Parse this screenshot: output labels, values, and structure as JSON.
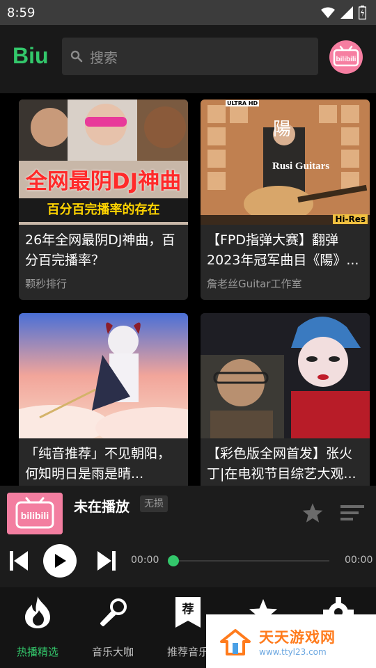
{
  "status_bar": {
    "time": "8:59"
  },
  "app_bar": {
    "logo": "Biu",
    "search": {
      "placeholder": "搜索"
    },
    "avatar_text": "bilibili"
  },
  "cards": [
    {
      "title": "26年全网最阴DJ神曲，百分百完播率？",
      "author": "颗秒排行",
      "thumb_text": "全网最阴DJ神曲",
      "thumb_sub": "百分百完播率的存在"
    },
    {
      "title": "【FPD指弹大赛】翻弹2023年冠军曲目《陽》...",
      "author": "詹老丝Guitar工作室",
      "thumb_text": "陽",
      "thumb_sub": "Rusi Guitars",
      "badge_tl": "ULTRA HD",
      "badge_br": "Hi-Res"
    },
    {
      "title": "「纯音推荐」不见朝阳，何知明日是雨是晴...",
      "author": ""
    },
    {
      "title": "【彩色版全网首发】张火丁|在电视节目综艺大观...",
      "author": ""
    }
  ],
  "player": {
    "title": "未在播放",
    "quality": "无损",
    "current_time": "00:00",
    "total_time": "00:00",
    "progress": 0
  },
  "bottom_nav": [
    {
      "label": "热播精选",
      "icon": "fire-icon",
      "active": true
    },
    {
      "label": "音乐大咖",
      "icon": "microphone-icon",
      "active": false
    },
    {
      "label": "推荐音乐",
      "icon": "bookmark-recommend-icon",
      "active": false,
      "glyph": "荐"
    },
    {
      "label": "",
      "icon": "star-icon",
      "active": false
    },
    {
      "label": "",
      "icon": "gear-icon",
      "active": false
    }
  ],
  "watermark": {
    "name": "天天游戏网",
    "url": "www.ttyl23.com"
  },
  "colors": {
    "accent": "#33c76b",
    "bilibili_pink": "#f67ea1",
    "watermark_orange": "#ff7b1c"
  }
}
